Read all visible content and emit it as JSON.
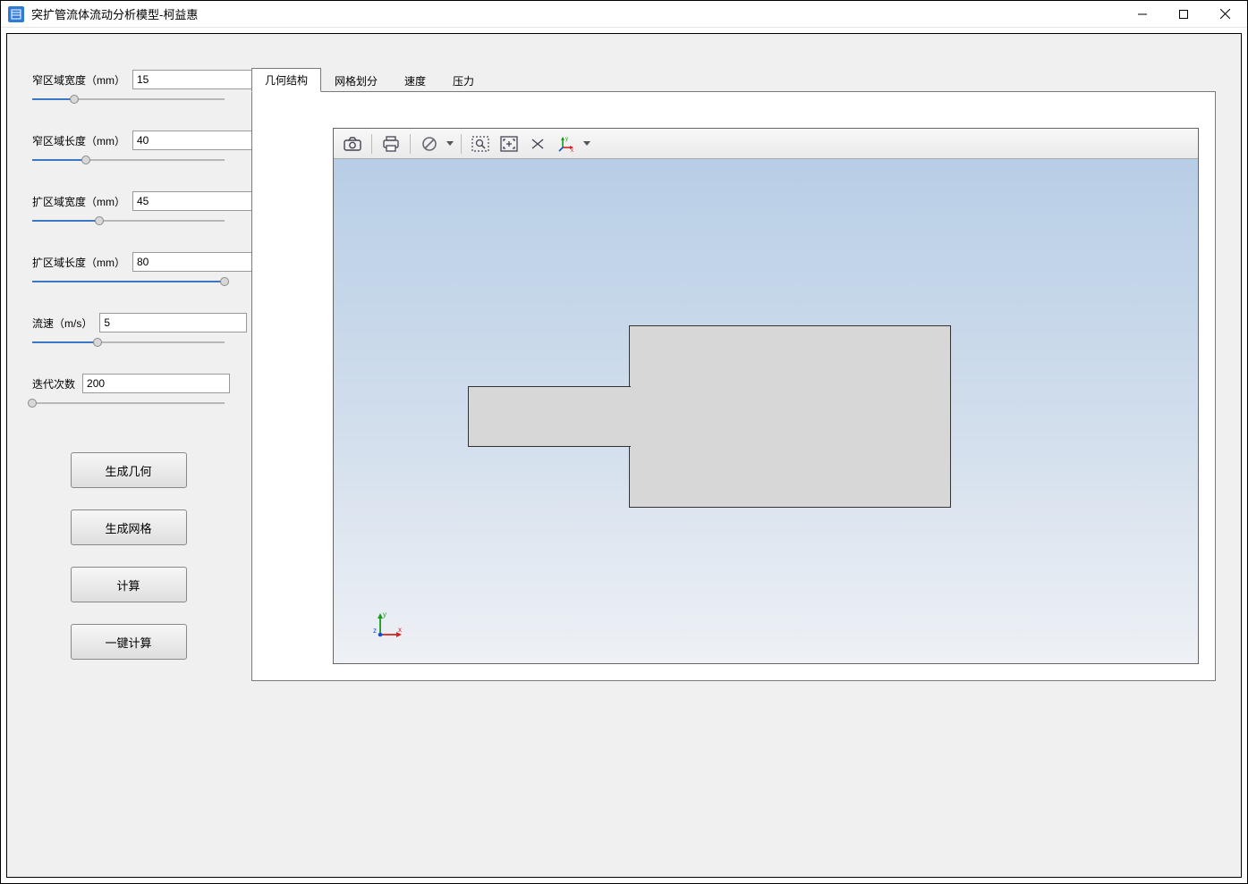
{
  "window": {
    "title": "突扩管流体流动分析模型-柯益惠"
  },
  "sidebar": {
    "params": [
      {
        "label": "窄区域宽度（mm）",
        "value": "15",
        "slider_pct": 22
      },
      {
        "label": "窄区域长度（mm）",
        "value": "40",
        "slider_pct": 28
      },
      {
        "label": "扩区域宽度（mm）",
        "value": "45",
        "slider_pct": 35
      },
      {
        "label": "扩区域长度（mm）",
        "value": "80",
        "slider_pct": 100
      },
      {
        "label": "流速（m/s）",
        "value": "5",
        "slider_pct": 34
      },
      {
        "label": "迭代次数",
        "value": "200",
        "slider_pct": 0
      }
    ],
    "buttons": {
      "gen_geom": "生成几何",
      "gen_mesh": "生成网格",
      "compute": "计算",
      "one_click": "一键计算"
    }
  },
  "tabs": [
    {
      "label": "几何结构",
      "active": true
    },
    {
      "label": "网格划分",
      "active": false
    },
    {
      "label": "速度",
      "active": false
    },
    {
      "label": "压力",
      "active": false
    }
  ],
  "toolbar": {
    "icons": [
      "camera",
      "print",
      "filter",
      "zoom-box",
      "fit-extents",
      "rotate",
      "axes"
    ]
  },
  "axis_labels": {
    "x": "x",
    "y": "y",
    "z": "z"
  }
}
